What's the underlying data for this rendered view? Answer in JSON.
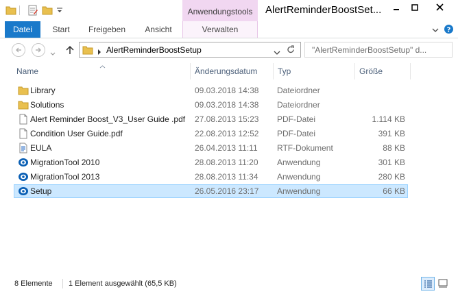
{
  "window": {
    "title": "AlertReminderBoostSet...",
    "context_tab_group": "Anwendungstools"
  },
  "ribbon": {
    "tabs": [
      "Datei",
      "Start",
      "Freigeben",
      "Ansicht",
      "Verwalten"
    ]
  },
  "address": {
    "path": "AlertReminderBoostSetup",
    "search_placeholder": "\"AlertReminderBoostSetup\" d..."
  },
  "columns": [
    "Name",
    "Änderungsdatum",
    "Typ",
    "Größe"
  ],
  "files": [
    {
      "name": "Library",
      "date": "09.03.2018 14:38",
      "type": "Dateiordner",
      "size": "",
      "icon": "folder-icon"
    },
    {
      "name": "Solutions",
      "date": "09.03.2018 14:38",
      "type": "Dateiordner",
      "size": "",
      "icon": "folder-icon"
    },
    {
      "name": "Alert Reminder Boost_V3_User Guide .pdf",
      "date": "27.08.2013 15:23",
      "type": "PDF-Datei",
      "size": "1.114 KB",
      "icon": "document-icon"
    },
    {
      "name": "Condition User Guide.pdf",
      "date": "22.08.2013 12:52",
      "type": "PDF-Datei",
      "size": "391 KB",
      "icon": "document-icon"
    },
    {
      "name": "EULA",
      "date": "26.04.2013 11:11",
      "type": "RTF-Dokument",
      "size": "88 KB",
      "icon": "rtf-document-icon"
    },
    {
      "name": "MigrationTool 2010",
      "date": "28.08.2013 11:20",
      "type": "Anwendung",
      "size": "301 KB",
      "icon": "application-icon"
    },
    {
      "name": "MigrationTool 2013",
      "date": "28.08.2013 11:34",
      "type": "Anwendung",
      "size": "280 KB",
      "icon": "application-icon"
    },
    {
      "name": "Setup",
      "date": "26.05.2016 23:17",
      "type": "Anwendung",
      "size": "66 KB",
      "icon": "application-icon",
      "selected": true
    }
  ],
  "status": {
    "count": "8 Elemente",
    "selection": "1 Element ausgewählt (65,5 KB)"
  },
  "colors": {
    "accent": "#1979ca",
    "selection_bg": "#cce8ff",
    "selection_border": "#99d1ff",
    "context_tab": "#f1d7f1"
  }
}
